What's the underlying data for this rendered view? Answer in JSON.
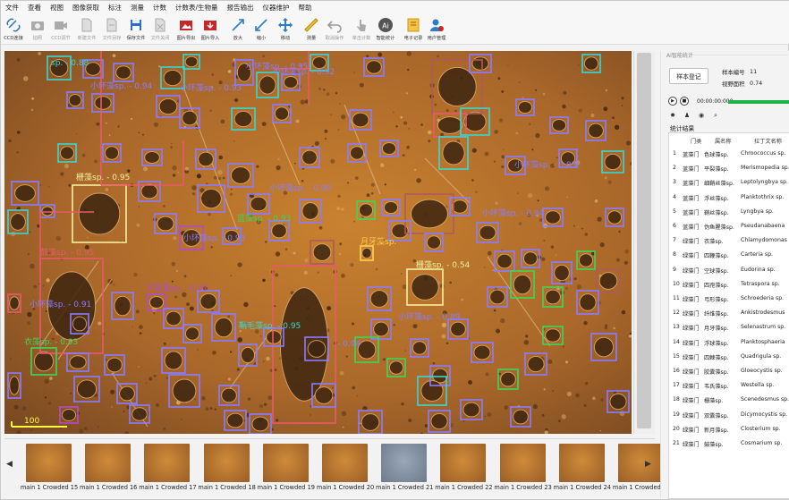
{
  "menu": [
    "文件",
    "查看",
    "视图",
    "图像获取",
    "标注",
    "测量",
    "计数",
    "计数表/生物量",
    "报告输出",
    "仪器维护",
    "帮助"
  ],
  "toolbar": [
    {
      "label": "CCD连接",
      "icon": "link-icon",
      "enabled": true
    },
    {
      "label": "拍照",
      "icon": "camera-icon",
      "enabled": false
    },
    {
      "label": "CCD调节",
      "icon": "video-camera-icon",
      "enabled": false
    },
    {
      "label": "新建文件",
      "icon": "new-file-icon",
      "enabled": false
    },
    {
      "label": "文件另存",
      "icon": "save-as-icon",
      "enabled": false
    },
    {
      "label": "保存文件",
      "icon": "save-icon",
      "enabled": true
    },
    {
      "label": "文件关闭",
      "icon": "close-file-icon",
      "enabled": false
    },
    {
      "label": "图片导出",
      "icon": "image-export-icon",
      "enabled": true
    },
    {
      "label": "图片导入",
      "icon": "image-import-icon",
      "enabled": true
    },
    {
      "label": "放大",
      "icon": "zoom-in-icon",
      "enabled": true
    },
    {
      "label": "缩小",
      "icon": "zoom-out-icon",
      "enabled": true
    },
    {
      "label": "移动",
      "icon": "move-icon",
      "enabled": true
    },
    {
      "label": "测量",
      "icon": "ruler-icon",
      "enabled": true
    },
    {
      "label": "取消操作",
      "icon": "undo-icon",
      "enabled": false
    },
    {
      "label": "单击计数",
      "icon": "click-count-icon",
      "enabled": false
    },
    {
      "label": "智能统计",
      "icon": "ai-icon",
      "enabled": true
    },
    {
      "label": "电子记录",
      "icon": "notebook-icon",
      "enabled": true
    },
    {
      "label": "用户管理",
      "icon": "user-settings-icon",
      "enabled": true
    }
  ],
  "detections": [
    {
      "label": "sp. - 0.88",
      "color": "#38d8d0"
    },
    {
      "label": "小环藻sp. - 0.94",
      "color": "#8a7cff"
    },
    {
      "label": "小环藻sp. - 0.93",
      "color": "#8a7cff"
    },
    {
      "label": "小环藻sp. - 0.95",
      "color": "#8a7cff"
    },
    {
      "label": "小环藻sp. - 0.92",
      "color": "#8a7cff"
    },
    {
      "label": "小环藻sp. - 0.90",
      "color": "#8a7cff"
    },
    {
      "label": "小环藻sp. - 0.83",
      "color": "#8a7cff"
    },
    {
      "label": "小环藻sp. - 0.94",
      "color": "#8a7cff"
    },
    {
      "label": "小环藻sp. - 0.93",
      "color": "#8a7cff"
    },
    {
      "label": "小环藻sp. - 0.89",
      "color": "#8a7cff"
    },
    {
      "label": "栅藻sp. - 0.95",
      "color": "#f4f0a0"
    },
    {
      "label": "栅藻sp. - 0.54",
      "color": "#f4f0a0"
    },
    {
      "label": "鼓藻sp. - 0.95",
      "color": "#e85a6a"
    },
    {
      "label": "月牙藻sp.",
      "color": "#ffd24a"
    },
    {
      "label": "平裂藻sp. - 0.97",
      "color": "#b44cc8"
    },
    {
      "label": "衣藻sp. - 0.93",
      "color": "#3ad858"
    },
    {
      "label": "蓝藻sp. - 0.93",
      "color": "#3ad858"
    },
    {
      "label": "鞘毛藻sp. - 0.95",
      "color": "#38d8d0"
    },
    {
      "label": "- 0.94",
      "color": "#8a7cff"
    },
    {
      "label": "小环藻sp. - 0.91",
      "color": "#8a7cff"
    }
  ],
  "scale_bar": "100",
  "thumbnails": [
    {
      "caption": "main 1 Crowded 15"
    },
    {
      "caption": "main 1 Crowded 16"
    },
    {
      "caption": "main 1 Crowded 17"
    },
    {
      "caption": "main 1 Crowded 18"
    },
    {
      "caption": "main 1 Crowded 19"
    },
    {
      "caption": "main 1 Crowded 20"
    },
    {
      "caption": "main 1 Crowded 21"
    },
    {
      "caption": "main 1 Crowded 22"
    },
    {
      "caption": "main 1 Crowded 23"
    },
    {
      "caption": "main 1 Crowded 24"
    },
    {
      "caption": "main 1 Crowded 25"
    }
  ],
  "right": {
    "panel_title": "AI智能统计",
    "sample_button": "样本登记",
    "sample_no_label": "样本编号",
    "sample_no": "11",
    "view_area_label": "视野面积",
    "view_area": "0.74",
    "timer": "00:00:00:000",
    "progress": 1.0,
    "stats_title": "统计结果",
    "columns": [
      "门类",
      "属名称",
      "拉丁文名称"
    ],
    "rows": [
      [
        "1",
        "蓝藻门",
        "色球藻sp.",
        "Chroococcus sp."
      ],
      [
        "2",
        "蓝藻门",
        "平裂藻sp.",
        "Merismopedia sp."
      ],
      [
        "3",
        "蓝藻门",
        "细鞘丝藻sp.",
        "Leptolyngbya sp."
      ],
      [
        "4",
        "蓝藻门",
        "浮丝藻sp.",
        "Planktothrix sp."
      ],
      [
        "5",
        "蓝藻门",
        "鞘丝藻sp.",
        "Lyngbya sp."
      ],
      [
        "6",
        "蓝藻门",
        "伪鱼腥藻sp.",
        "Pseudanabaena"
      ],
      [
        "7",
        "绿藻门",
        "衣藻sp.",
        "Chlamydomonas"
      ],
      [
        "8",
        "绿藻门",
        "四鞭藻sp.",
        "Carteria sp."
      ],
      [
        "9",
        "绿藻门",
        "空球藻sp.",
        "Eudorina sp."
      ],
      [
        "10",
        "绿藻门",
        "四孢藻sp.",
        "Tetraspora sp."
      ],
      [
        "11",
        "绿藻门",
        "弓形藻sp.",
        "Schroederia sp."
      ],
      [
        "12",
        "绿藻门",
        "纤维藻sp.",
        "Ankistrodesmus"
      ],
      [
        "13",
        "绿藻门",
        "月牙藻sp.",
        "Selenastrum sp."
      ],
      [
        "14",
        "绿藻门",
        "浮球藻sp.",
        "Planktosphaeria"
      ],
      [
        "15",
        "绿藻门",
        "四棘藻sp.",
        "Quadrigula sp."
      ],
      [
        "16",
        "绿藻门",
        "胶囊藻sp.",
        "Gloeocystis sp."
      ],
      [
        "17",
        "绿藻门",
        "韦氏藻sp.",
        "Westella sp."
      ],
      [
        "18",
        "绿藻门",
        "栅藻sp.",
        "Scenedesmus sp."
      ],
      [
        "19",
        "绿藻门",
        "双囊藻sp.",
        "Dicymocystis sp."
      ],
      [
        "20",
        "绿藻门",
        "新月藻sp.",
        "Closterium sp."
      ],
      [
        "21",
        "绿藻门",
        "鼓藻sp.",
        "Cosmarium sp."
      ]
    ]
  }
}
